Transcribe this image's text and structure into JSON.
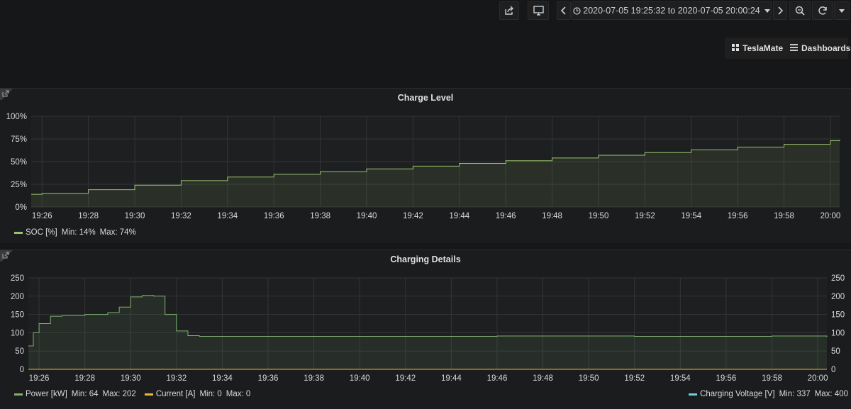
{
  "toolbar": {
    "share_icon": "share-icon",
    "tv_icon": "monitor-icon",
    "time_range": "2020-07-05 19:25:32 to 2020-07-05 20:00:24",
    "zoom_icon": "search-minus-icon",
    "refresh_icon": "refresh-icon"
  },
  "nav": {
    "teslamate": "TeslaMate",
    "dashboards": "Dashboards"
  },
  "colors": {
    "soc": "#9ac46c",
    "power": "#7eb26d",
    "current": "#eab839",
    "voltage": "#6ed0e0"
  },
  "charge_level": {
    "title": "Charge Level",
    "legend": {
      "series": "SOC [%]",
      "min": "Min: 14%",
      "max": "Max: 74%"
    }
  },
  "charging_details": {
    "title": "Charging Details",
    "legend": {
      "power": {
        "series": "Power [kW]",
        "min": "Min: 64",
        "max": "Max: 202"
      },
      "current": {
        "series": "Current [A]",
        "min": "Min: 0",
        "max": "Max: 0"
      },
      "voltage": {
        "series": "Charging Voltage [V]",
        "min": "Min: 337",
        "max": "Max: 400"
      }
    }
  },
  "chart_data": [
    {
      "type": "area",
      "title": "Charge Level",
      "x_tick_labels": [
        "19:26",
        "19:28",
        "19:30",
        "19:32",
        "19:34",
        "19:36",
        "19:38",
        "19:40",
        "19:42",
        "19:44",
        "19:46",
        "19:48",
        "19:50",
        "19:52",
        "19:54",
        "19:56",
        "19:58",
        "20:00"
      ],
      "y_tick_labels": [
        "0%",
        "25%",
        "50%",
        "75%",
        "100%"
      ],
      "ylim": [
        0,
        100
      ],
      "xlim": [
        "19:25:32",
        "20:00:24"
      ],
      "grid": true,
      "legend_position": "bottom-left",
      "series": [
        {
          "name": "SOC [%]",
          "x": [
            "19:25:32",
            "19:26",
            "19:28",
            "19:30",
            "19:32",
            "19:34",
            "19:36",
            "19:38",
            "19:40",
            "19:42",
            "19:44",
            "19:46",
            "19:48",
            "19:50",
            "19:52",
            "19:54",
            "19:56",
            "19:58",
            "20:00",
            "20:00:24"
          ],
          "values": [
            14,
            15,
            19,
            24,
            29,
            33,
            36,
            39,
            42,
            45,
            48,
            51,
            54,
            57,
            60,
            63,
            66,
            69,
            73,
            74
          ]
        }
      ]
    },
    {
      "type": "area",
      "title": "Charging Details",
      "x_tick_labels": [
        "19:26",
        "19:28",
        "19:30",
        "19:32",
        "19:34",
        "19:36",
        "19:38",
        "19:40",
        "19:42",
        "19:44",
        "19:46",
        "19:48",
        "19:50",
        "19:52",
        "19:54",
        "19:56",
        "19:58",
        "20:00"
      ],
      "y_tick_labels": [
        "0",
        "50",
        "100",
        "150",
        "200",
        "250"
      ],
      "ylim": [
        0,
        250
      ],
      "y2_tick_labels": [
        "0",
        "50",
        "100",
        "150",
        "200",
        "250"
      ],
      "y2lim": [
        0,
        250
      ],
      "xlim": [
        "19:25:32",
        "20:00:24"
      ],
      "grid": true,
      "legend_position": "bottom",
      "series": [
        {
          "name": "Power [kW]",
          "x": [
            "19:25:32",
            "19:25:45",
            "19:26",
            "19:26:30",
            "19:27",
            "19:28",
            "19:29",
            "19:29:30",
            "19:30",
            "19:30:30",
            "19:31",
            "19:31:30",
            "19:32",
            "19:32:30",
            "19:33",
            "19:34",
            "19:40",
            "19:46",
            "19:52",
            "19:58",
            "20:00",
            "20:00:24"
          ],
          "values": [
            64,
            100,
            125,
            145,
            147,
            150,
            155,
            170,
            198,
            202,
            200,
            150,
            105,
            92,
            90,
            90,
            90,
            91,
            90,
            91,
            91,
            88
          ]
        },
        {
          "name": "Current [A]",
          "x": [
            "19:25:32",
            "20:00:24"
          ],
          "values": [
            0,
            0
          ]
        }
      ]
    }
  ]
}
